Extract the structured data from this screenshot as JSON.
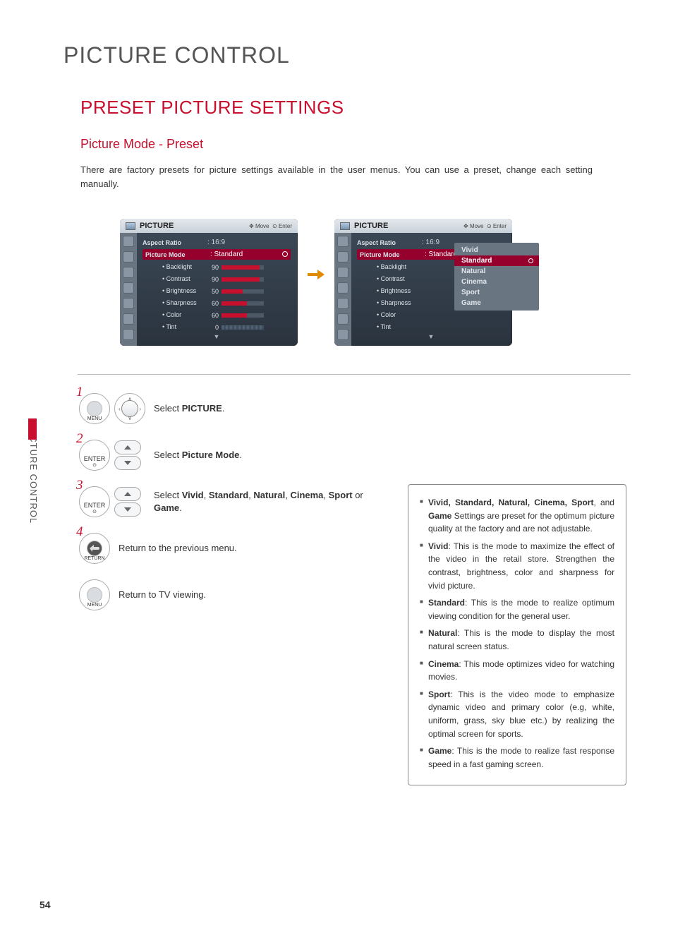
{
  "page": {
    "title": "PICTURE CONTROL",
    "section": "PRESET PICTURE SETTINGS",
    "subsection": "Picture Mode - Preset",
    "intro": "There are factory presets for picture settings available in the user menus. You can use a preset, change each setting manually.",
    "number": "54",
    "side_tab": "PICTURE CONTROL"
  },
  "osd": {
    "title": "PICTURE",
    "hint_move": "Move",
    "hint_enter": "Enter",
    "aspect_label": "Aspect Ratio",
    "aspect_value": ": 16:9",
    "mode_label": "Picture Mode",
    "mode_value": ": Standard",
    "items": [
      {
        "label": "• Backlight",
        "value": "90",
        "fill": 90
      },
      {
        "label": "• Contrast",
        "value": "90",
        "fill": 90
      },
      {
        "label": "• Brightness",
        "value": "50",
        "fill": 50
      },
      {
        "label": "• Sharpness",
        "value": "60",
        "fill": 60
      },
      {
        "label": "• Color",
        "value": "60",
        "fill": 60
      },
      {
        "label": "• Tint",
        "value": "0",
        "fill": 50,
        "tint": true
      }
    ],
    "popup": [
      "Vivid",
      "Standard",
      "Natural",
      "Cinema",
      "Sport",
      "Game"
    ]
  },
  "steps": {
    "s1_pre": "Select ",
    "s1_b": "PICTURE",
    "s2_pre": "Select ",
    "s2_b": "Picture Mode",
    "s3_pre": "Select ",
    "s3_b1": "Vivid",
    "s3_c1": ", ",
    "s3_b2": "Standard",
    "s3_c2": ", ",
    "s3_b3": "Natural",
    "s3_c3": ", ",
    "s3_b4": "Cinema",
    "s3_c4": ", ",
    "s3_b5": "Sport",
    "s3_c5": " or ",
    "s3_b6": "Game",
    "s4": "Return to the previous menu.",
    "s5": "Return to TV viewing.",
    "btn_menu": "MENU",
    "btn_enter": "ENTER",
    "btn_return": "RETURN"
  },
  "info": {
    "presets_list": "Vivid, Standard, Natural, Cinema, Sport",
    "presets_and": ", and ",
    "presets_game": "Game",
    "presets_rest": " Settings are preset for the optimum picture quality at the factory and are not adjustable.",
    "vivid_b": "Vivid",
    "vivid": ": This is the mode to maximize the effect of the video in the retail store. Strengthen the contrast, brightness, color and sharpness for vivid picture.",
    "standard_b": "Standard",
    "standard": ": This is the mode to realize optimum viewing condition for the general user.",
    "natural_b": "Natural",
    "natural": ": This is the mode to display the most natural screen status.",
    "cinema_b": "Cinema",
    "cinema": ": This mode optimizes video for watching movies.",
    "sport_b": "Sport",
    "sport": ": This is the video mode to emphasize dynamic video and primary color (e.g, white, uniform, grass, sky blue etc.) by realizing the optimal screen for sports.",
    "game_b": "Game",
    "game": ": This is the mode to realize fast response speed in a fast gaming screen."
  }
}
